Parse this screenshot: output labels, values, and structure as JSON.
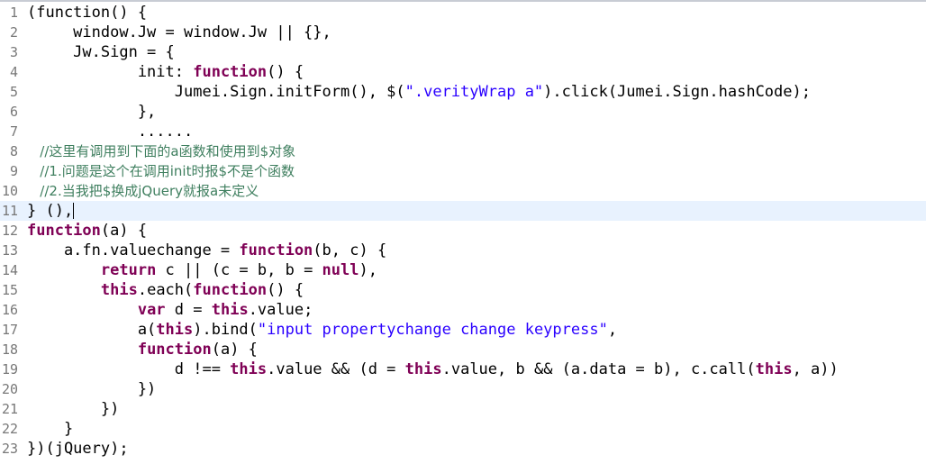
{
  "editor": {
    "current_line": 11,
    "lines": [
      {
        "n": "1",
        "segs": [
          [
            "p",
            "(function() {"
          ]
        ]
      },
      {
        "n": "2",
        "segs": [
          [
            "p",
            "     window.Jw = window.Jw || {},"
          ]
        ]
      },
      {
        "n": "3",
        "segs": [
          [
            "p",
            "     Jw.Sign = {"
          ]
        ]
      },
      {
        "n": "4",
        "segs": [
          [
            "p",
            "            init: "
          ],
          [
            "k",
            "function"
          ],
          [
            "p",
            "() {"
          ]
        ]
      },
      {
        "n": "5",
        "segs": [
          [
            "p",
            "                Jumei.Sign.initForm(), $("
          ],
          [
            "s",
            "\".verityWrap a\""
          ],
          [
            "p",
            ").click(Jumei.Sign.hashCode);"
          ]
        ]
      },
      {
        "n": "6",
        "segs": [
          [
            "p",
            "            },"
          ]
        ]
      },
      {
        "n": "7",
        "segs": [
          [
            "p",
            "            ......"
          ]
        ]
      },
      {
        "n": "8",
        "segs": [
          [
            "c",
            "   //这里有调用到下面的a函数和使用到$对象"
          ]
        ]
      },
      {
        "n": "9",
        "segs": [
          [
            "c",
            "   //1.问题是这个在调用init时报$不是个函数"
          ]
        ]
      },
      {
        "n": "10",
        "segs": [
          [
            "c",
            "   //2.当我把$换成jQuery就报a未定义"
          ]
        ]
      },
      {
        "n": "11",
        "segs": [
          [
            "p",
            "} (),"
          ]
        ]
      },
      {
        "n": "12",
        "segs": [
          [
            "k",
            "function"
          ],
          [
            "p",
            "(a) {"
          ]
        ]
      },
      {
        "n": "13",
        "segs": [
          [
            "p",
            "    a.fn.valuechange = "
          ],
          [
            "k",
            "function"
          ],
          [
            "p",
            "(b, c) {"
          ]
        ]
      },
      {
        "n": "14",
        "segs": [
          [
            "p",
            "        "
          ],
          [
            "k",
            "return"
          ],
          [
            "p",
            " c || (c = b, b = "
          ],
          [
            "k",
            "null"
          ],
          [
            "p",
            "),"
          ]
        ]
      },
      {
        "n": "15",
        "segs": [
          [
            "p",
            "        "
          ],
          [
            "k",
            "this"
          ],
          [
            "p",
            ".each("
          ],
          [
            "k",
            "function"
          ],
          [
            "p",
            "() {"
          ]
        ]
      },
      {
        "n": "16",
        "segs": [
          [
            "p",
            "            "
          ],
          [
            "k",
            "var"
          ],
          [
            "p",
            " d = "
          ],
          [
            "k",
            "this"
          ],
          [
            "p",
            ".value;"
          ]
        ]
      },
      {
        "n": "17",
        "segs": [
          [
            "p",
            "            a("
          ],
          [
            "k",
            "this"
          ],
          [
            "p",
            ").bind("
          ],
          [
            "s",
            "\"input propertychange change keypress\""
          ],
          [
            "p",
            ","
          ]
        ]
      },
      {
        "n": "18",
        "segs": [
          [
            "p",
            "            "
          ],
          [
            "k",
            "function"
          ],
          [
            "p",
            "(a) {"
          ]
        ]
      },
      {
        "n": "19",
        "segs": [
          [
            "p",
            "                d !== "
          ],
          [
            "k",
            "this"
          ],
          [
            "p",
            ".value && (d = "
          ],
          [
            "k",
            "this"
          ],
          [
            "p",
            ".value, b && (a.data = b), c.call("
          ],
          [
            "k",
            "this"
          ],
          [
            "p",
            ", a))"
          ]
        ]
      },
      {
        "n": "20",
        "segs": [
          [
            "p",
            "            })"
          ]
        ]
      },
      {
        "n": "21",
        "segs": [
          [
            "p",
            "        })"
          ]
        ]
      },
      {
        "n": "22",
        "segs": [
          [
            "p",
            "    }"
          ]
        ]
      },
      {
        "n": "23",
        "segs": [
          [
            "p",
            "})(jQuery);"
          ]
        ]
      }
    ]
  }
}
